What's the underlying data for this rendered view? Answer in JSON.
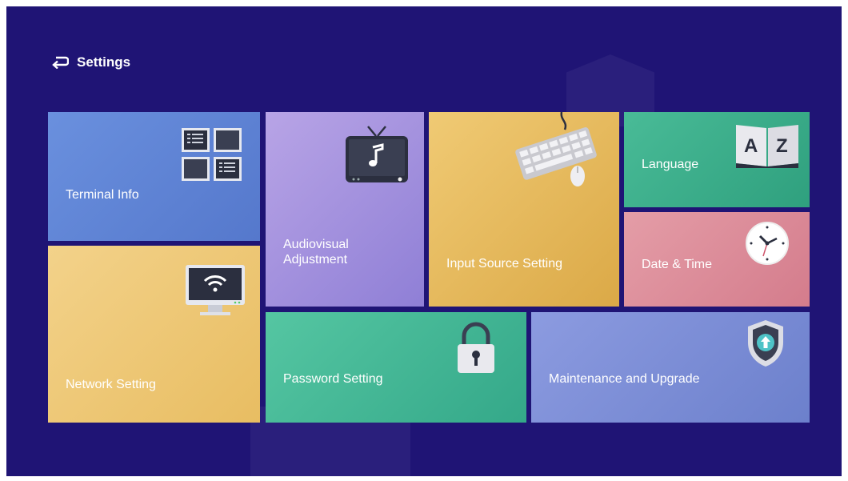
{
  "header": {
    "back_icon": "return-arrow-icon",
    "title": "Settings"
  },
  "tiles": {
    "terminal_info": {
      "label": "Terminal Info",
      "icon": "grid-panels-icon",
      "color": "#5f86d6"
    },
    "audiovisual": {
      "label1": "Audiovisual",
      "label2": "Adjustment",
      "icon": "tv-music-icon",
      "color": "#a692dd"
    },
    "input_source": {
      "label": "Input Source Setting",
      "icon": "keyboard-mouse-icon",
      "color": "#e6bd62"
    },
    "language": {
      "label": "Language",
      "icon": "az-book-icon",
      "icon_letters": "A Z",
      "color": "#3aaf8c"
    },
    "date_time": {
      "label": "Date & Time",
      "icon": "clock-icon",
      "color": "#dd8e9a"
    },
    "network": {
      "label": "Network Setting",
      "icon": "wifi-monitor-icon",
      "color": "#ecc775"
    },
    "password": {
      "label": "Password Setting",
      "icon": "padlock-icon",
      "color": "#46b896"
    },
    "maintenance": {
      "label": "Maintenance and Upgrade",
      "icon": "shield-upgrade-icon",
      "color": "#7f8fd6"
    }
  }
}
